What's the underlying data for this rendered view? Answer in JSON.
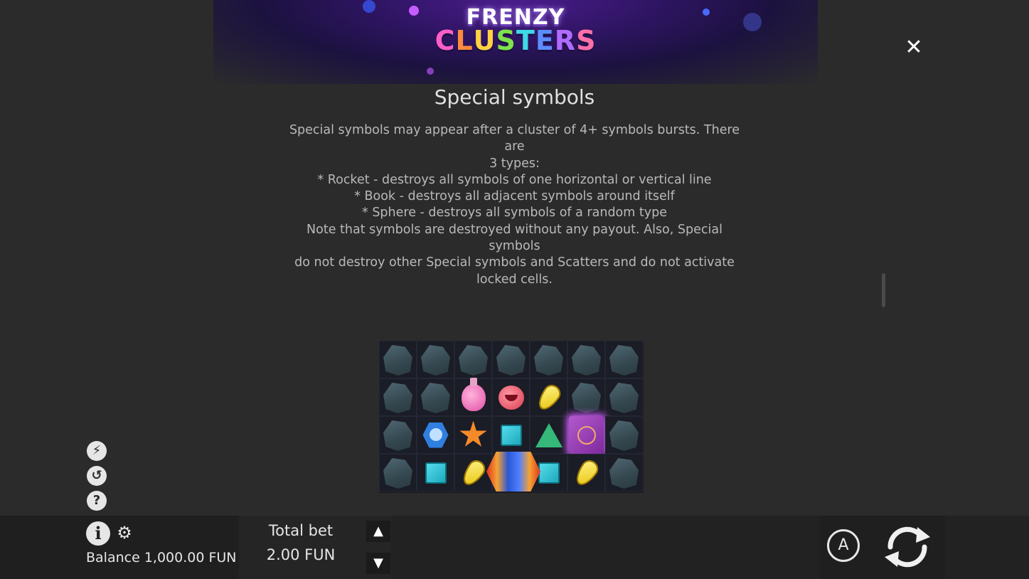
{
  "logo": {
    "line1": "FRENZY",
    "line2": [
      "C",
      "L",
      "U",
      "S",
      "T",
      "E",
      "R",
      "S"
    ],
    "line2_colors": [
      "#ff5ec8",
      "#ff8a3d",
      "#ffd23f",
      "#7ee34a",
      "#3fd9e8",
      "#5c8dff",
      "#b06cff",
      "#ff6fa8"
    ]
  },
  "close": {
    "glyph": "✕"
  },
  "section": {
    "title": "Special symbols",
    "body": "Special symbols may appear after a cluster of 4+ symbols bursts. There are\n3 types:\n* Rocket - destroys all symbols of one horizontal or vertical line\n* Book - destroys all adjacent symbols around itself\n* Sphere - destroys all symbols of a random type\nNote that symbols are destroyed without any payout. Also, Special symbols\ndo not destroy other Special symbols and Scatters and do not activate\nlocked cells."
  },
  "grid": {
    "rows": [
      [
        "rock",
        "rock",
        "rock",
        "rock",
        "rock",
        "rock",
        "rock"
      ],
      [
        "rock",
        "rock",
        "potion",
        "redpot",
        "yellowgem",
        "rock",
        "rock"
      ],
      [
        "rock",
        "skull",
        "star",
        "teal",
        "tri",
        "book",
        "rock"
      ],
      [
        "rock",
        "teal",
        "yellowgem",
        "empty",
        "teal",
        "yellowgem",
        "rock"
      ]
    ]
  },
  "side_icons": [
    {
      "name": "turbo-icon",
      "glyph": "⚡"
    },
    {
      "name": "history-icon",
      "glyph": "↺"
    },
    {
      "name": "help-icon",
      "glyph": "?"
    }
  ],
  "footer": {
    "info_glyph": "i",
    "gear_glyph": "⚙",
    "balance": "Balance 1,000.00 FUN",
    "bet_label": "Total bet",
    "bet_value": "2.00 FUN",
    "bet_up": "▲",
    "bet_down": "▼",
    "auto_label": "A"
  }
}
